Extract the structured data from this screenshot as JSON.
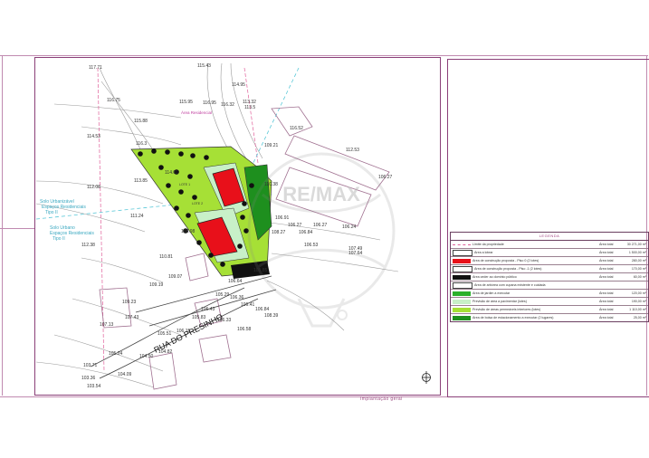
{
  "plan": {
    "street_name": "RUA DO PRESINHO",
    "footer_label": "Implantação geral",
    "watermark": "RE/MAX",
    "zones": [
      {
        "label": "Solo Urbanizável",
        "sub1": "Espaços Residenciais",
        "sub2": "Tipo II"
      },
      {
        "label": "Solo Urbano",
        "sub1": "Espaços Residenciais",
        "sub2": "Tipo II"
      }
    ],
    "area_label": "Área Residencial",
    "lots": [
      "LOTE 1",
      "LOTE 2"
    ],
    "elevations": [
      "117.71",
      "115.43",
      "116.75",
      "115.95",
      "114.95",
      "116.95",
      "113.32",
      "116.32",
      "113.5",
      "115.88",
      "114.53",
      "116.3",
      "114.01",
      "109.21",
      "116.52",
      "113.85",
      "112.08",
      "110.38",
      "106.27",
      "112.53",
      "111.24",
      "106.91",
      "106.27",
      "106.27",
      "106.24",
      "106.84",
      "112.38",
      "108.27",
      "106.53",
      "107.49",
      "107.64",
      "110.81",
      "106.98",
      "105.85",
      "109.07",
      "106.64",
      "105.29",
      "109.19",
      "106.36",
      "106.84",
      "105.83",
      "106.43",
      "106.41",
      "106.33",
      "108.39",
      "109.23",
      "107.43",
      "107.13",
      "106.58",
      "106.15",
      "105.51",
      "104.82",
      "105.24",
      "104.50",
      "103.71",
      "104.09",
      "103.36",
      "103.54"
    ]
  },
  "legend": {
    "title": "LEGENDA",
    "rows": [
      {
        "label": "Limite da propriedade",
        "col": "Área total",
        "value": "30 271,00 m²",
        "color": "#e0609a",
        "swatch": "dash"
      },
      {
        "label": "Área a lotear",
        "col": "Área total",
        "value": "1 500,00 m²",
        "color": "#ffffff",
        "swatch": "box"
      },
      {
        "label": "Área de construção proposta - Piso 0 (2 lotes)",
        "col": "Área total",
        "value": "280,00 m²",
        "color": "#e8101a",
        "swatch": "fill"
      },
      {
        "label": "Área de construção proposta - Piso -1 (2 lotes)",
        "col": "Área total",
        "value": "170,00 m²",
        "color": "#ffffff",
        "swatch": "box"
      },
      {
        "label": "Área ceder ao domínio público",
        "col": "Área total",
        "value": "60,00 m²",
        "color": "#111111",
        "swatch": "fill"
      },
      {
        "label": "Área de arbórea com cupana existente e cuidada",
        "col": "",
        "value": "",
        "color": "#ffffff",
        "swatch": "box"
      },
      {
        "label": "Área de jardim a executar",
        "col": "Área total",
        "value": "120,00 m²",
        "color": "#2bb02b",
        "swatch": "fill"
      },
      {
        "label": "Previsão de área a pavimentar (lotes)",
        "col": "Área total",
        "value": "190,00 m²",
        "color": "#c8f0c8",
        "swatch": "fill"
      },
      {
        "label": "Previsão de áreas permeáveis interiores (lotes)",
        "col": "Área total",
        "value": "1 110,00 m²",
        "color": "#a6e036",
        "swatch": "fill"
      },
      {
        "label": "Área de bolsa de estacionamento a executar (2 lugares)",
        "col": "Área total",
        "value": "25,00 m²",
        "color": "#1e8f1e",
        "swatch": "fill"
      }
    ]
  }
}
